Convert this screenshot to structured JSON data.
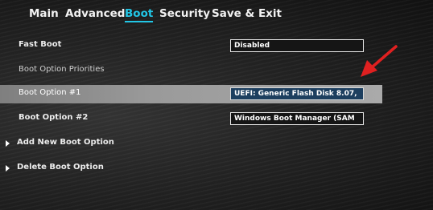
{
  "tabs": [
    "Main",
    "Advanced",
    "Boot",
    "Security",
    "Save & Exit"
  ],
  "rows": {
    "fast_boot": {
      "label": "Fast Boot",
      "value": "Disabled"
    },
    "priorities": {
      "label": "Boot Option Priorities"
    },
    "option1": {
      "label": "Boot Option #1",
      "value": "UEFI: Generic Flash Disk 8.07,"
    },
    "option2": {
      "label": "Boot Option #2",
      "value": "Windows Boot Manager (SAM"
    },
    "add_new": {
      "label": "Add New Boot Option"
    },
    "delete": {
      "label": "Delete Boot Option"
    }
  },
  "colors": {
    "active_tab": "#22c6e6",
    "annotation_arrow": "#e02020",
    "selected_value_bg": "#1d3f5f"
  },
  "icons": {
    "submenu": "triangle-right-icon",
    "annotation": "red-arrow-icon"
  }
}
